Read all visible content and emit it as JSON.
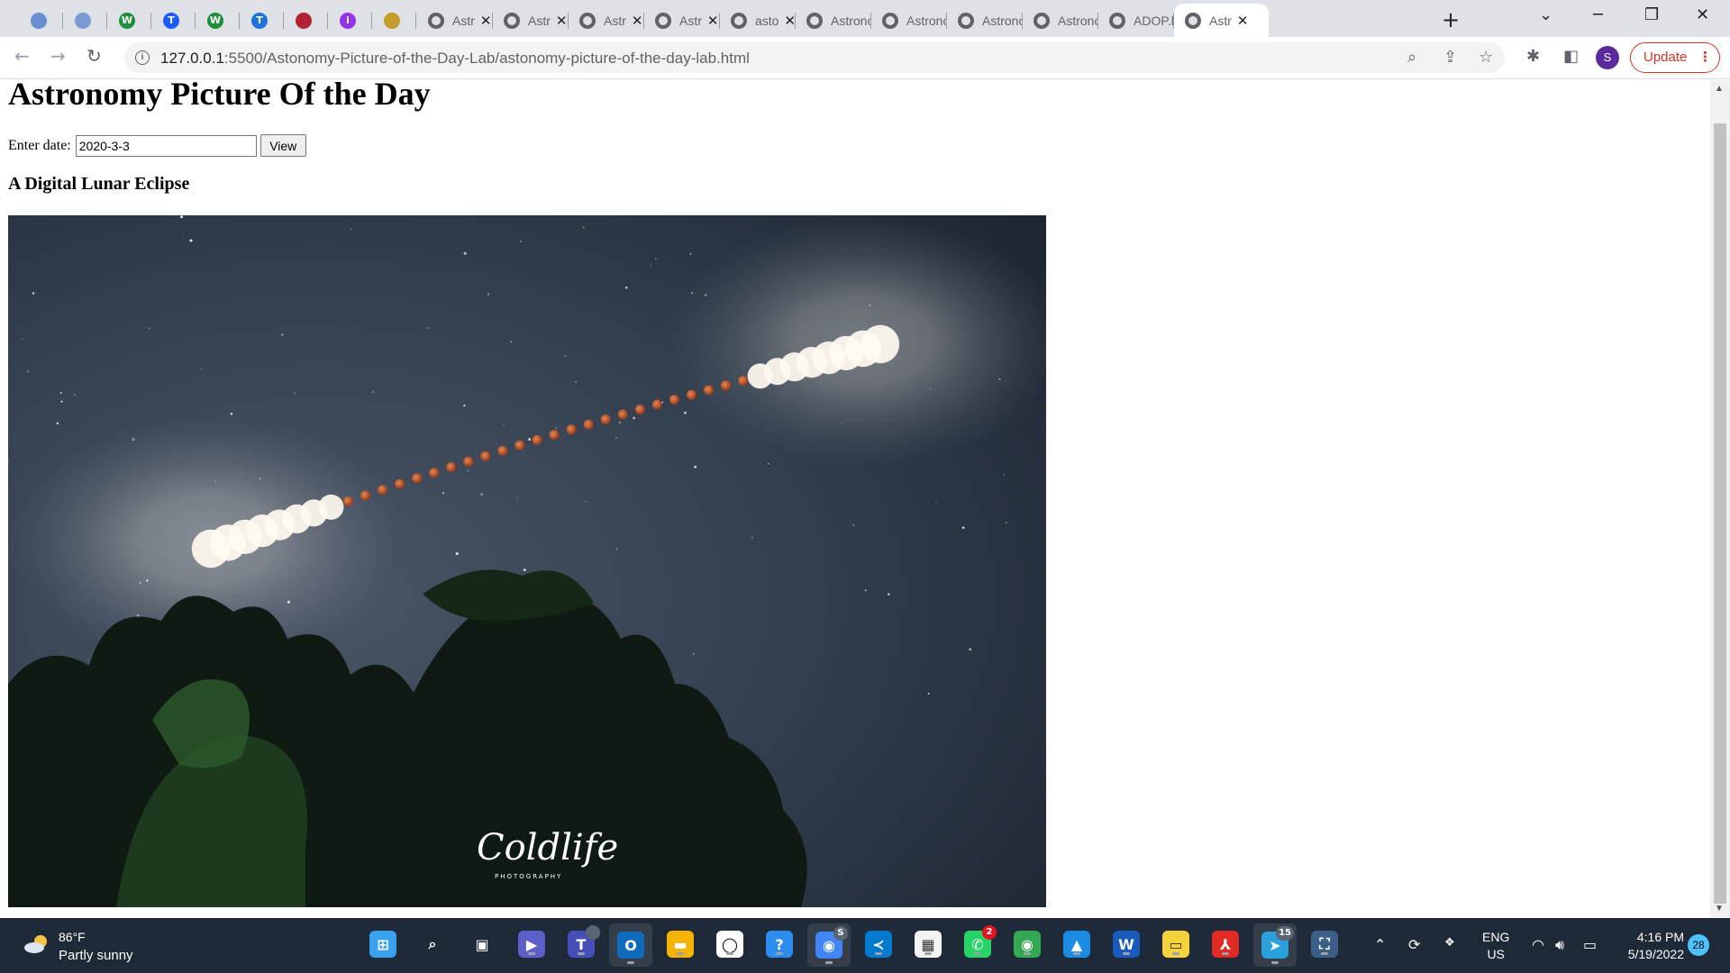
{
  "browser": {
    "pinned_tabs": [
      {
        "icon": "globe-seal-icon",
        "color": "#6a8fd0",
        "glyph": ""
      },
      {
        "icon": "globe-seal-icon",
        "color": "#7c9bd2",
        "glyph": ""
      },
      {
        "icon": "w-letter-icon",
        "color": "#1f8f3a",
        "glyph": "W"
      },
      {
        "icon": "t-square-icon",
        "color": "#1a5cff",
        "glyph": "T"
      },
      {
        "icon": "w-letter-icon",
        "color": "#1f8f3a",
        "glyph": "W"
      },
      {
        "icon": "t-italic-icon",
        "color": "#1d74d8",
        "glyph": "T"
      },
      {
        "icon": "flag-icon",
        "color": "#b22234",
        "glyph": ""
      },
      {
        "icon": "purple-circle-icon",
        "color": "#9333ea",
        "glyph": "i"
      },
      {
        "icon": "badge-icon",
        "color": "#c59b2a",
        "glyph": ""
      }
    ],
    "tabs": [
      {
        "title": "Astr",
        "closable": true
      },
      {
        "title": "Astr",
        "closable": true
      },
      {
        "title": "Astr",
        "closable": true
      },
      {
        "title": "Astr",
        "closable": true
      },
      {
        "title": "asto",
        "closable": true
      },
      {
        "title": "Astrono",
        "closable": false
      },
      {
        "title": "Astrono",
        "closable": false
      },
      {
        "title": "Astrono",
        "closable": false
      },
      {
        "title": "Astrono",
        "closable": false
      },
      {
        "title": "ADOP.h",
        "closable": false
      },
      {
        "title": "Astr",
        "closable": true,
        "active": true
      }
    ],
    "url_host": "127.0.0.1",
    "url_rest": ":5500/Astonomy-Picture-of-the-Day-Lab/astonomy-picture-of-the-day-lab.html",
    "profile_initial": "S",
    "update_label": "Update"
  },
  "page": {
    "heading": "Astronomy Picture Of the Day",
    "date_label": "Enter date:",
    "date_value": "2020-3-3",
    "view_button": "View",
    "picture_title": "A Digital Lunar Eclipse",
    "photo_signature": "Coldlife",
    "photo_signature_sub": "PHOTOGRAPHY"
  },
  "taskbar": {
    "weather_temp": "86°F",
    "weather_desc": "Partly sunny",
    "badges": {
      "teams": "",
      "whatsapp": "2",
      "telegram": "15",
      "chrome_profile": "S"
    },
    "lang_line1": "ENG",
    "lang_line2": "US",
    "time": "4:16 PM",
    "date": "5/19/2022",
    "notifications": "28"
  }
}
